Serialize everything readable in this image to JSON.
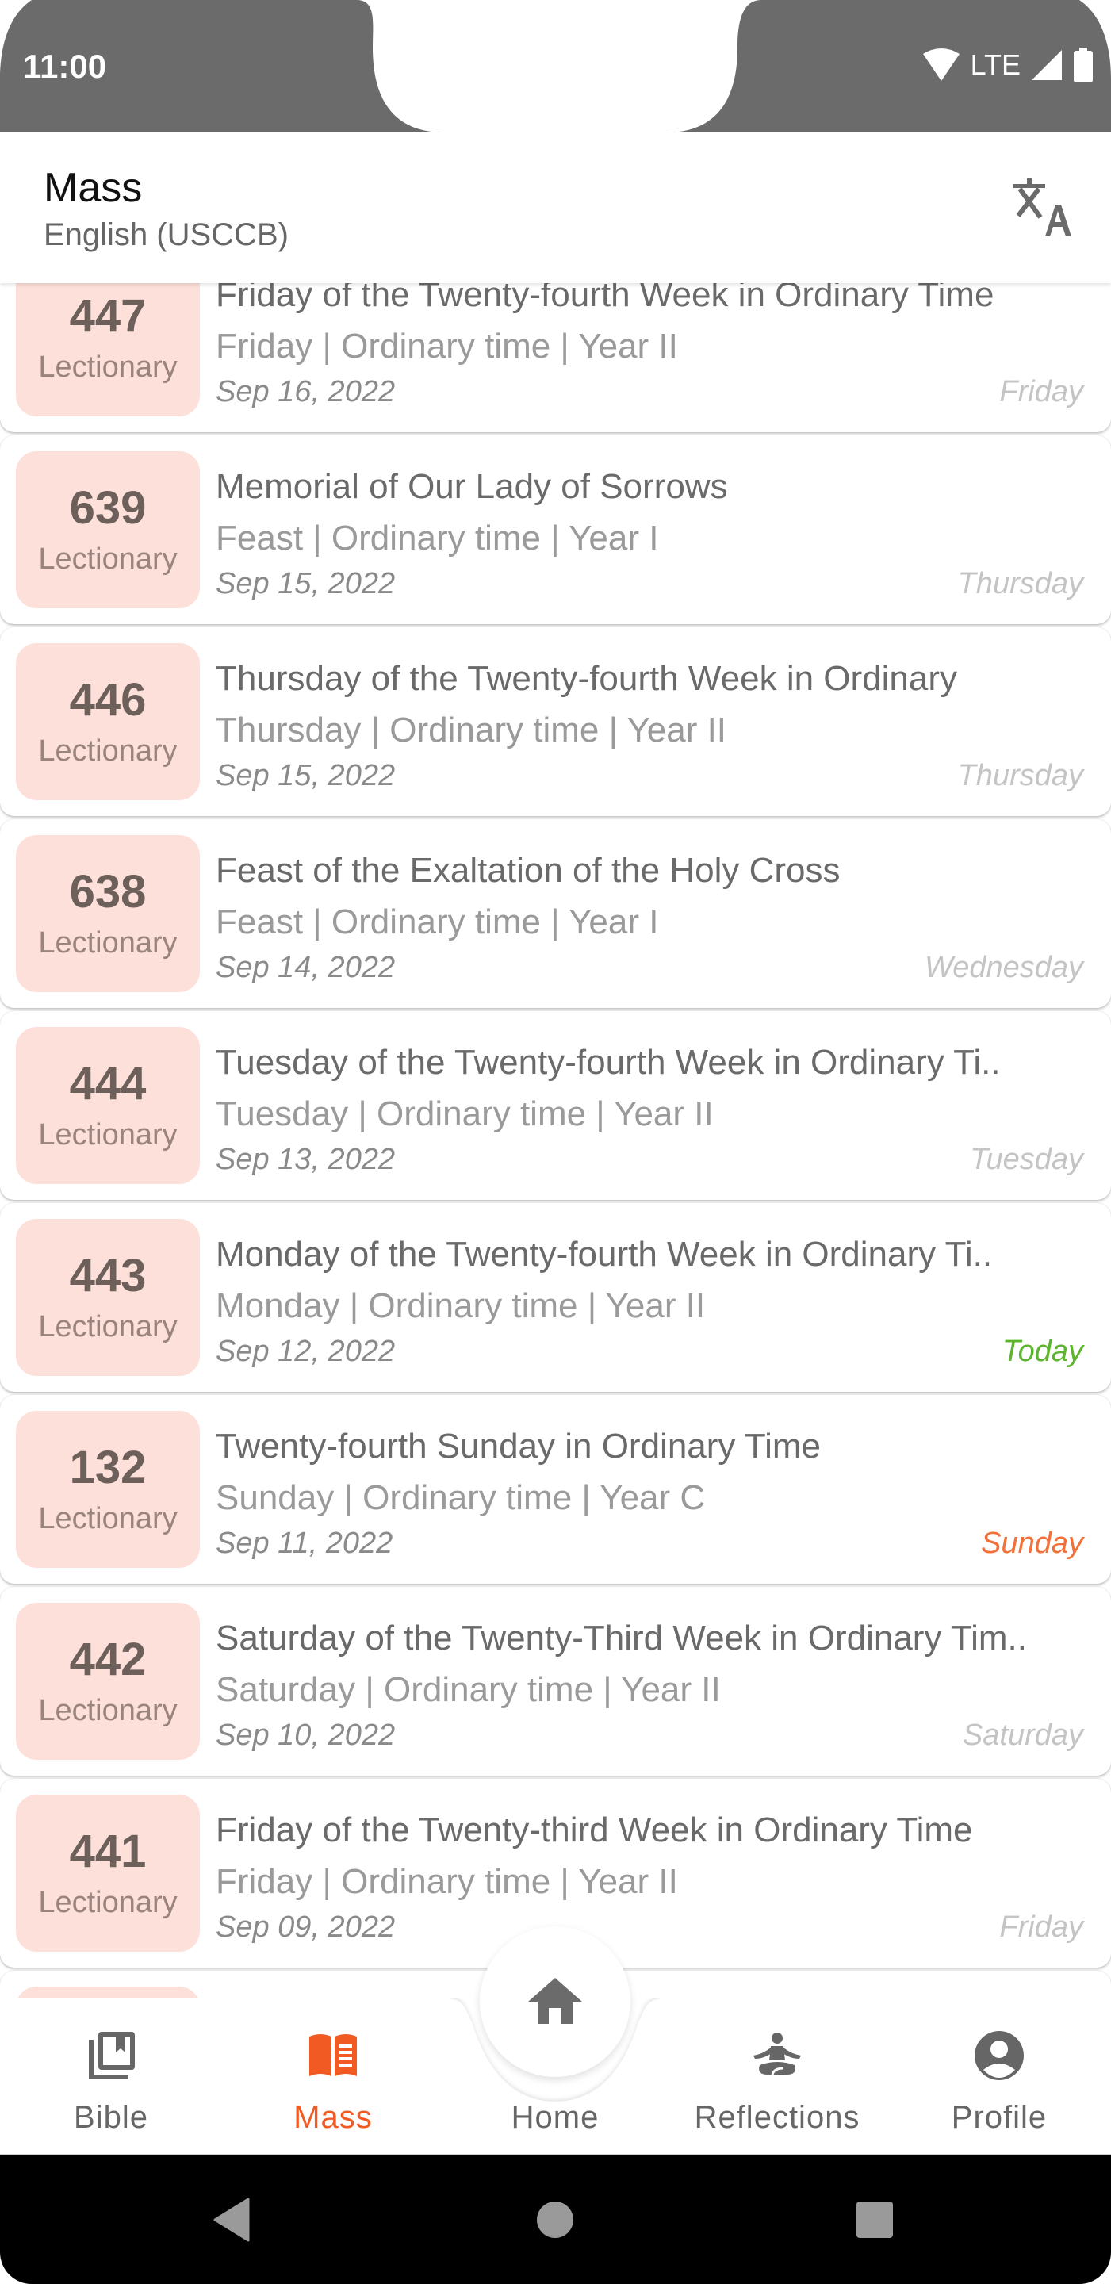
{
  "status_bar": {
    "time": "11:00",
    "network": "LTE",
    "icons": [
      "wifi-icon",
      "signal-icon",
      "battery-icon"
    ]
  },
  "header": {
    "title": "Mass",
    "subtitle": "English (USCCB)",
    "action_icon": "translate-icon"
  },
  "colors": {
    "accent": "#f25a24",
    "badge_bg": "#fde0d9",
    "today": "#5db42f",
    "sunday": "#f2703a",
    "status_bar": "#6b6b6b"
  },
  "readings": [
    {
      "number": "447",
      "label": "Lectionary",
      "title": "Friday of the Twenty-fourth Week in Ordinary Time",
      "subtitle": "Friday | Ordinary time | Year II",
      "date": "Sep 16, 2022",
      "day": "Friday",
      "day_type": "normal"
    },
    {
      "number": "639",
      "label": "Lectionary",
      "title": "Memorial of Our Lady of Sorrows",
      "subtitle": "Feast | Ordinary time | Year I",
      "date": "Sep 15, 2022",
      "day": "Thursday",
      "day_type": "normal"
    },
    {
      "number": "446",
      "label": "Lectionary",
      "title": "Thursday of the Twenty-fourth Week in Ordinary",
      "subtitle": "Thursday | Ordinary time | Year II",
      "date": "Sep 15, 2022",
      "day": "Thursday",
      "day_type": "normal"
    },
    {
      "number": "638",
      "label": "Lectionary",
      "title": "Feast of the Exaltation of the Holy Cross",
      "subtitle": "Feast | Ordinary time | Year I",
      "date": "Sep 14, 2022",
      "day": "Wednesday",
      "day_type": "normal"
    },
    {
      "number": "444",
      "label": "Lectionary",
      "title": "Tuesday of the Twenty-fourth Week in Ordinary Ti..",
      "subtitle": "Tuesday | Ordinary time | Year II",
      "date": "Sep 13, 2022",
      "day": "Tuesday",
      "day_type": "normal"
    },
    {
      "number": "443",
      "label": "Lectionary",
      "title": "Monday of the Twenty-fourth Week in Ordinary Ti..",
      "subtitle": "Monday | Ordinary time | Year II",
      "date": "Sep 12, 2022",
      "day": "Today",
      "day_type": "today"
    },
    {
      "number": "132",
      "label": "Lectionary",
      "title": "Twenty-fourth Sunday in Ordinary Time",
      "subtitle": "Sunday | Ordinary time | Year C",
      "date": "Sep 11, 2022",
      "day": "Sunday",
      "day_type": "sunday"
    },
    {
      "number": "442",
      "label": "Lectionary",
      "title": "Saturday of the Twenty-Third Week in Ordinary Tim..",
      "subtitle": "Saturday | Ordinary time | Year II",
      "date": "Sep 10, 2022",
      "day": "Saturday",
      "day_type": "normal"
    },
    {
      "number": "441",
      "label": "Lectionary",
      "title": "Friday of the Twenty-third Week in Ordinary Time",
      "subtitle": "Friday | Ordinary time | Year II",
      "date": "Sep 09, 2022",
      "day": "Friday",
      "day_type": "normal"
    },
    {
      "number": "",
      "label": "",
      "title": "",
      "subtitle": "",
      "date": "",
      "day": "",
      "day_type": "normal"
    }
  ],
  "bottom_nav": {
    "items": [
      {
        "label": "Bible",
        "icon": "bible-icon",
        "active": false
      },
      {
        "label": "Mass",
        "icon": "mass-book-icon",
        "active": true
      },
      {
        "label": "Home",
        "icon": "home-icon",
        "active": false
      },
      {
        "label": "Reflections",
        "icon": "meditation-icon",
        "active": false
      },
      {
        "label": "Profile",
        "icon": "profile-icon",
        "active": false
      }
    ]
  },
  "system_nav": {
    "buttons": [
      "back",
      "home",
      "recents"
    ]
  }
}
